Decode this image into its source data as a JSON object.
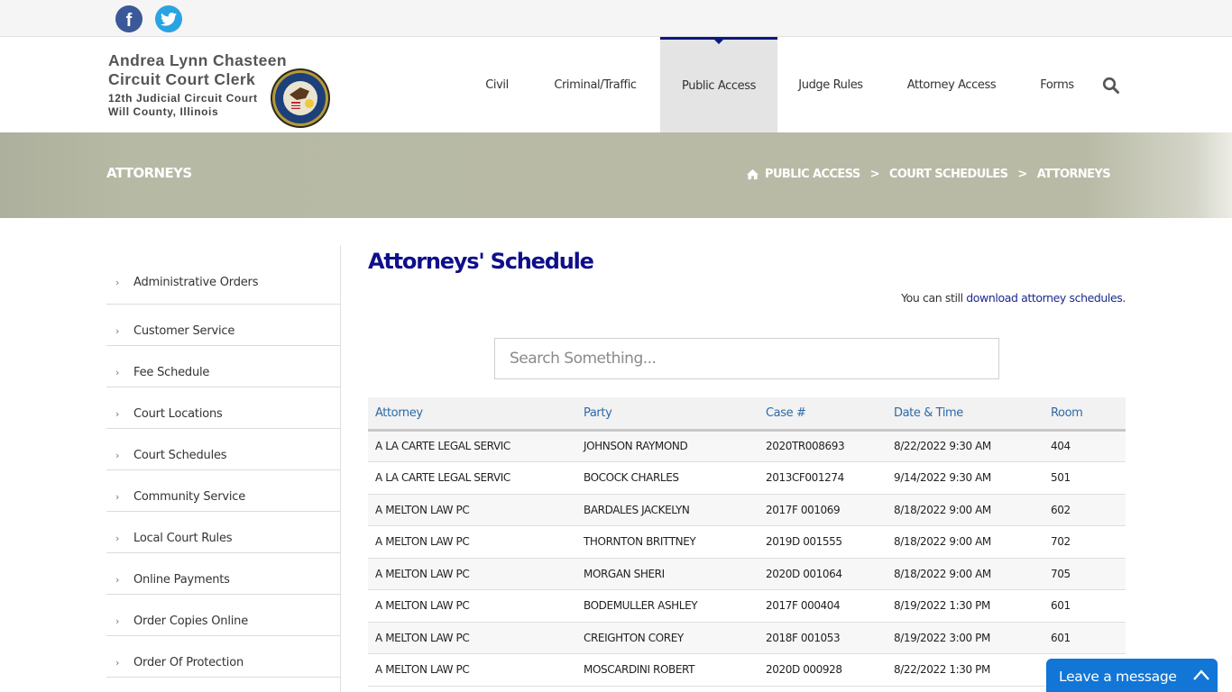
{
  "social": {
    "facebook": {
      "icon": "facebook-icon",
      "glyph": "f",
      "color": "#3b5998"
    },
    "twitter": {
      "icon": "twitter-icon",
      "color": "#2aa3e3"
    }
  },
  "logo": {
    "line1": "Andrea Lynn Chasteen",
    "line2": "Circuit Court Clerk",
    "line3": "12th Judicial Circuit Court",
    "line4": "Will County, Illinois",
    "seal": "Twelfth Judicial Circuit Court Will County Illinois seal"
  },
  "nav": {
    "items": [
      {
        "label": "Civil",
        "active": false
      },
      {
        "label": "Criminal/Traffic",
        "active": false
      },
      {
        "label": "Public Access",
        "active": true
      },
      {
        "label": "Judge Rules",
        "active": false
      },
      {
        "label": "Attorney Access",
        "active": false
      },
      {
        "label": "Forms",
        "active": false
      }
    ],
    "search_icon": "search-icon",
    "accent_color": "#0b1a80"
  },
  "banner": {
    "title": "ATTORNEYS",
    "breadcrumb": [
      {
        "label": "PUBLIC ACCESS"
      },
      {
        "label": "COURT SCHEDULES"
      },
      {
        "label": "ATTORNEYS"
      }
    ],
    "separator": ">"
  },
  "sidebar": {
    "items": [
      {
        "label": "Administrative Orders"
      },
      {
        "label": "Customer Service"
      },
      {
        "label": "Fee Schedule"
      },
      {
        "label": "Court Locations"
      },
      {
        "label": "Court Schedules"
      },
      {
        "label": "Community Service"
      },
      {
        "label": "Local Court Rules"
      },
      {
        "label": "Online Payments"
      },
      {
        "label": "Order Copies Online"
      },
      {
        "label": "Order Of Protection"
      }
    ]
  },
  "main": {
    "title": "Attorneys' Schedule",
    "note_prefix": "You can still ",
    "note_link": "download attorney schedules",
    "note_suffix": ".",
    "search_placeholder": "Search Something...",
    "search_value": "",
    "table": {
      "columns": [
        "Attorney",
        "Party",
        "Case #",
        "Date & Time",
        "Room"
      ],
      "rows": [
        [
          "A LA CARTE LEGAL SERVIC",
          "JOHNSON RAYMOND",
          "2020TR008693",
          "8/22/2022 9:30 AM",
          "404"
        ],
        [
          "A LA CARTE LEGAL SERVIC",
          "BOCOCK CHARLES",
          "2013CF001274",
          "9/14/2022 9:30 AM",
          "501"
        ],
        [
          "A MELTON LAW PC",
          "BARDALES JACKELYN",
          "2017F 001069",
          "8/18/2022 9:00 AM",
          "602"
        ],
        [
          "A MELTON LAW PC",
          "THORNTON BRITTNEY",
          "2019D 001555",
          "8/18/2022 9:00 AM",
          "702"
        ],
        [
          "A MELTON LAW PC",
          "MORGAN SHERI",
          "2020D 001064",
          "8/18/2022 9:00 AM",
          "705"
        ],
        [
          "A MELTON LAW PC",
          "BODEMULLER ASHLEY",
          "2017F 000404",
          "8/19/2022 1:30 PM",
          "601"
        ],
        [
          "A MELTON LAW PC",
          "CREIGHTON COREY",
          "2018F 001053",
          "8/19/2022 3:00 PM",
          "601"
        ],
        [
          "A MELTON LAW PC",
          "MOSCARDINI ROBERT",
          "2020D 000928",
          "8/22/2022 1:30 PM",
          ""
        ]
      ]
    }
  },
  "chat": {
    "label": "Leave a message",
    "color": "#1176d6"
  }
}
